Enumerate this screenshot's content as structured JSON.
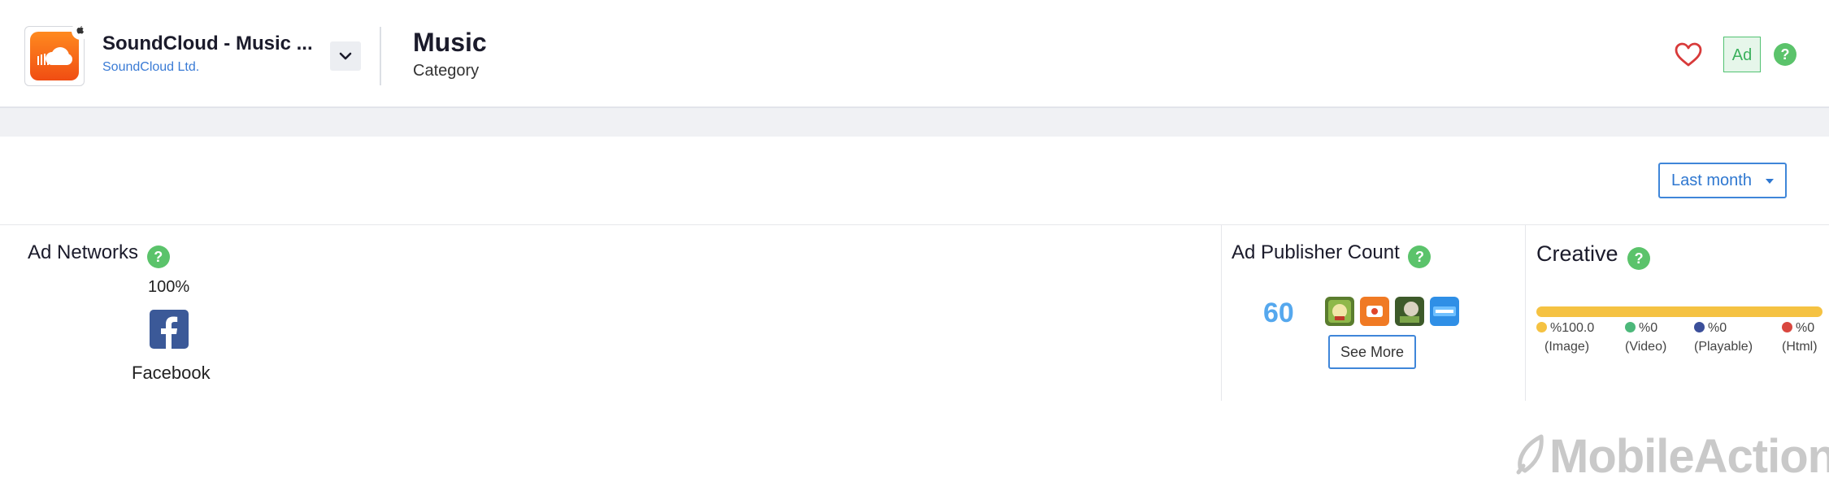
{
  "header": {
    "app_title": "SoundCloud - Music ...",
    "developer": "SoundCloud Ltd.",
    "category_title": "Music",
    "category_label": "Category",
    "ad_badge": "Ad",
    "help": "?"
  },
  "filter": {
    "period_label": "Last month"
  },
  "ad_networks": {
    "title": "Ad Networks",
    "help": "?",
    "items": [
      {
        "name": "Facebook",
        "percent": "100%"
      }
    ]
  },
  "ad_publishers": {
    "title": "Ad Publisher Count",
    "help": "?",
    "count": "60",
    "see_more": "See More"
  },
  "creative": {
    "title": "Creative",
    "help": "?",
    "items": [
      {
        "value": "%100.0",
        "label": "(Image)",
        "color": "#f5c242",
        "fraction": 1.0
      },
      {
        "value": "%0",
        "label": "(Video)",
        "color": "#4cb87a",
        "fraction": 0
      },
      {
        "value": "%0",
        "label": "(Playable)",
        "color": "#3b4f9a",
        "fraction": 0
      },
      {
        "value": "%0",
        "label": "(Html)",
        "color": "#d9473f",
        "fraction": 0
      }
    ]
  },
  "watermark": "MobileAction"
}
